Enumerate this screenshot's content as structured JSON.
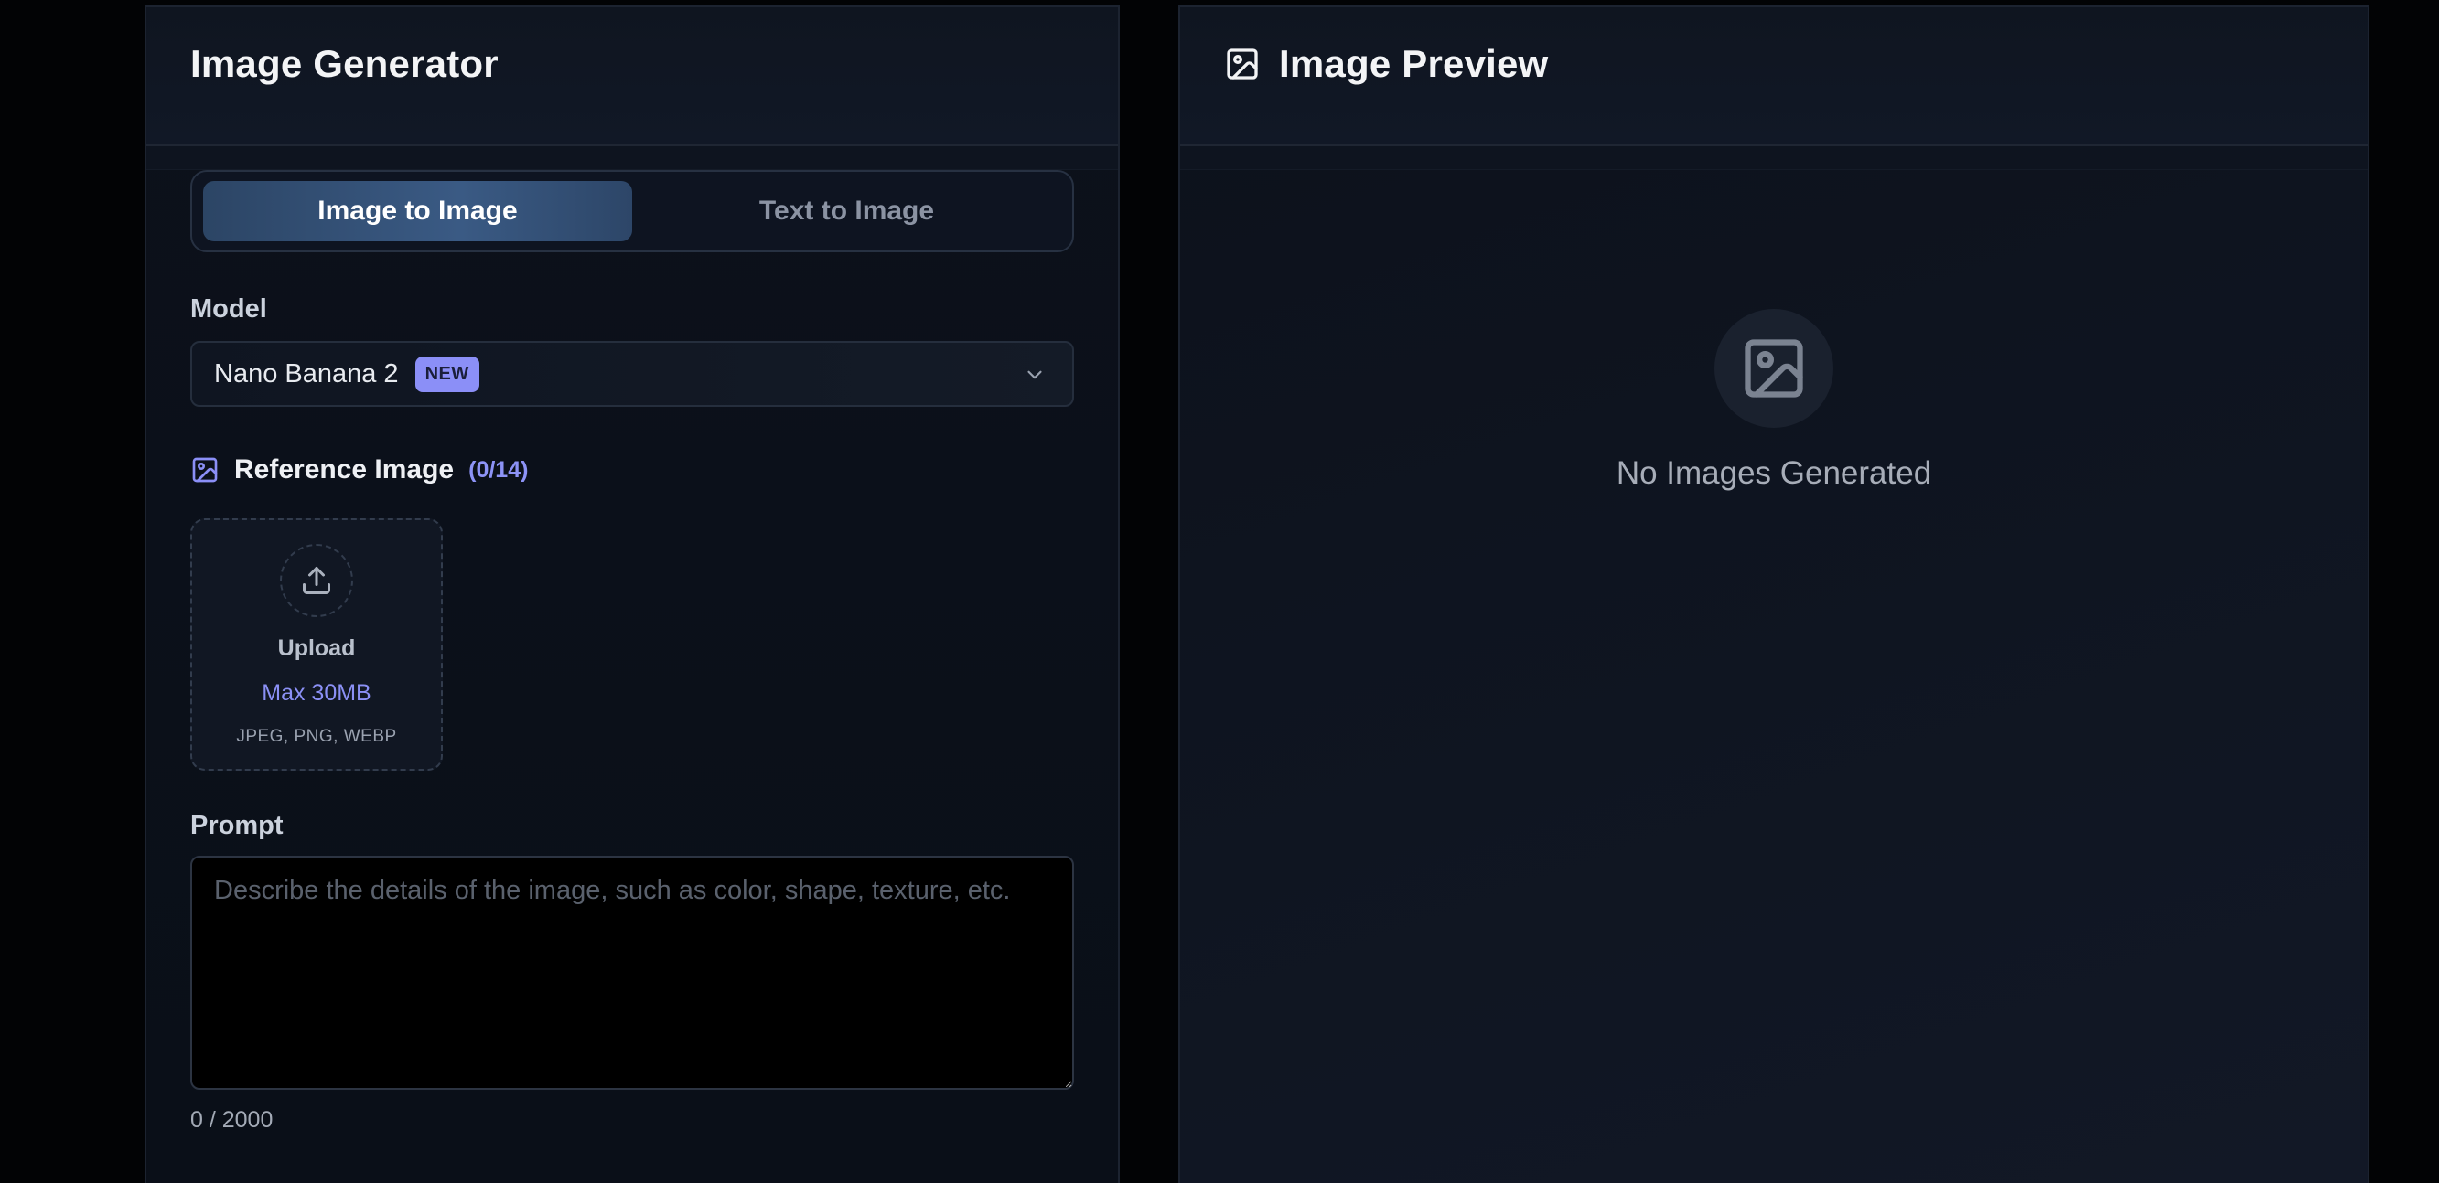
{
  "left_panel": {
    "title": "Image Generator",
    "mode_tabs": [
      {
        "label": "Image to Image",
        "active": true
      },
      {
        "label": "Text to Image",
        "active": false
      }
    ],
    "model": {
      "label": "Model",
      "selected": "Nano Banana 2",
      "badge": "NEW"
    },
    "reference": {
      "label": "Reference Image",
      "count": "(0/14)",
      "upload_label": "Upload",
      "max_size": "Max 30MB",
      "types": "JPEG, PNG, WEBP"
    },
    "prompt": {
      "label": "Prompt",
      "value": "",
      "placeholder": "Describe the details of the image, such as color, shape, texture, etc.",
      "counter": "0 / 2000"
    }
  },
  "right_panel": {
    "title": "Image Preview",
    "empty_message": "No Images Generated"
  },
  "colors": {
    "accent": "#8b8ff7",
    "active_tab": "#3a5a84",
    "background": "#020305"
  },
  "icons": [
    "image-icon",
    "chevron-down-icon",
    "upload-icon",
    "image-placeholder-icon"
  ]
}
